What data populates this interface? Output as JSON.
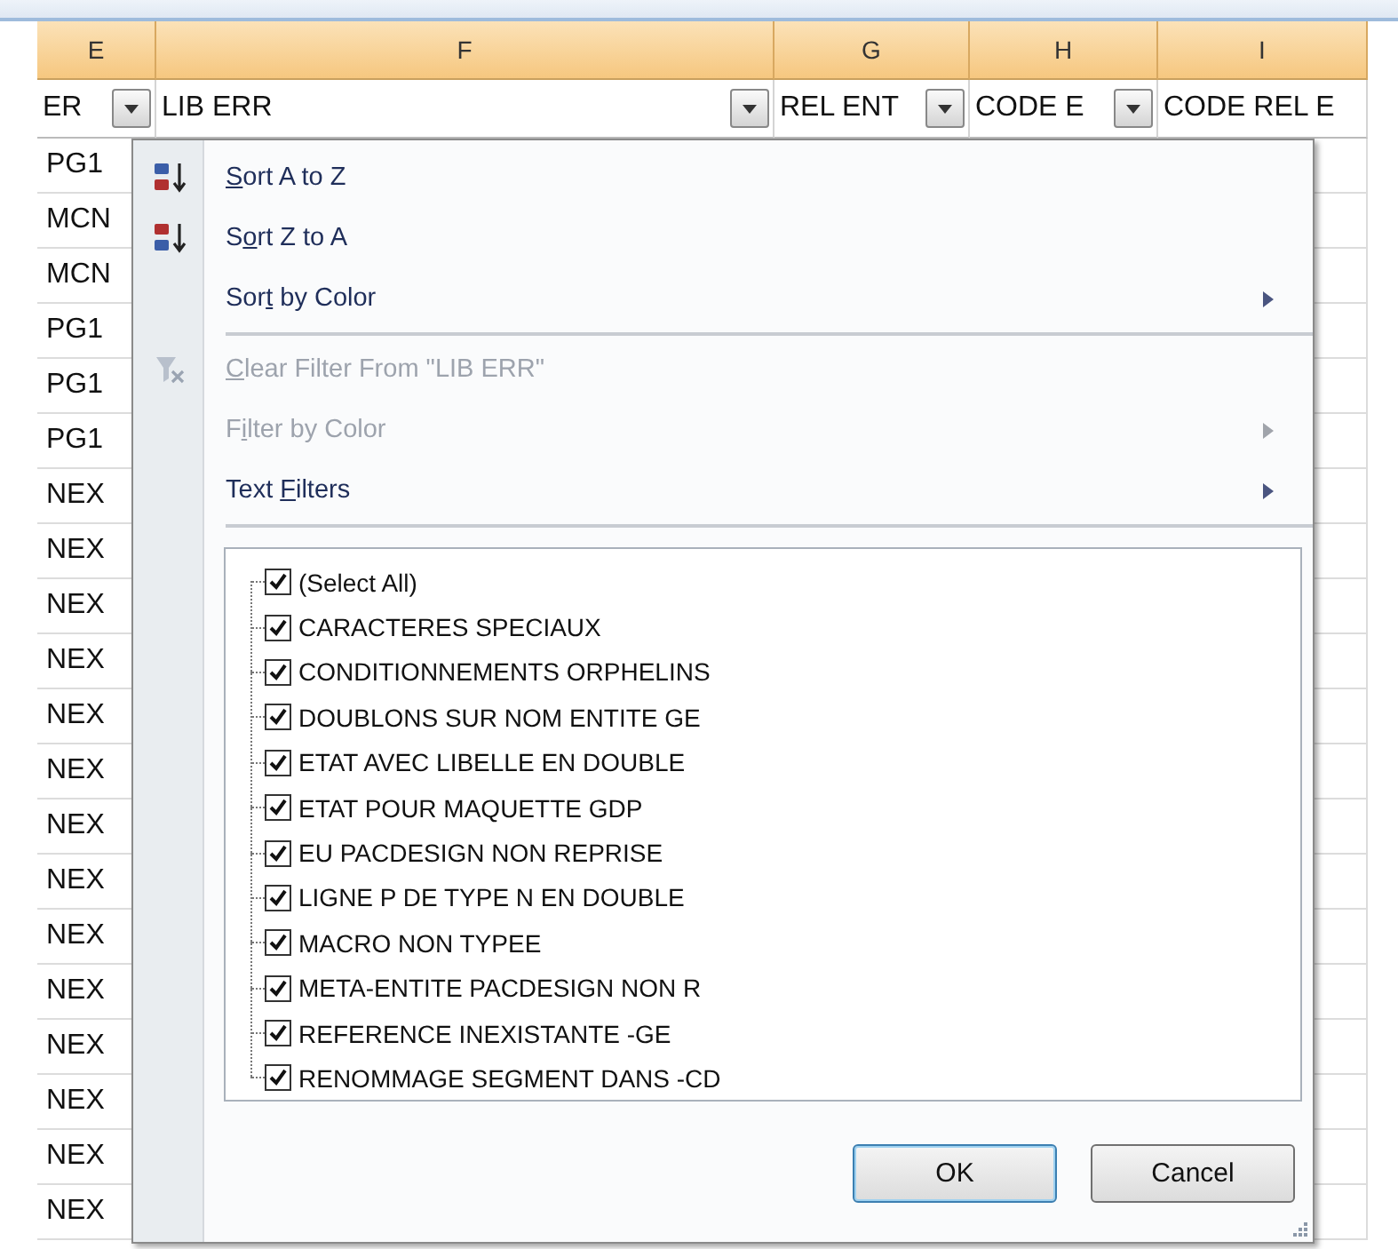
{
  "columns": [
    {
      "letter": "E"
    },
    {
      "letter": "F"
    },
    {
      "letter": "G"
    },
    {
      "letter": "H"
    },
    {
      "letter": "I"
    }
  ],
  "filter_row": [
    {
      "label": "ER",
      "filter_button": true
    },
    {
      "label": "LIB ERR",
      "filter_button": true
    },
    {
      "label": "REL ENT",
      "filter_button": true
    },
    {
      "label": "CODE E",
      "filter_button": true
    },
    {
      "label": "CODE REL E",
      "filter_button": false
    }
  ],
  "rows": [
    "PG1",
    "MCN",
    "MCN",
    "PG1",
    "PG1",
    "PG1",
    "NEX",
    "NEX",
    "NEX",
    "NEX",
    "NEX",
    "NEX",
    "NEX",
    "NEX",
    "NEX",
    "NEX",
    "NEX",
    "NEX",
    "NEX",
    "NEX"
  ],
  "filter_menu": {
    "items": [
      {
        "kind": "sort-ascending",
        "mnemonic": "S",
        "after": "ort A to Z",
        "disabled": false,
        "submenu": false
      },
      {
        "kind": "sort-descending",
        "before": "S",
        "mnemonic": "o",
        "after": "rt Z to A",
        "disabled": false,
        "submenu": false
      },
      {
        "kind": "command",
        "before": "Sor",
        "mnemonic": "t",
        "after": " by Color",
        "disabled": false,
        "submenu": true
      },
      {
        "kind": "separator"
      },
      {
        "kind": "clear-filter",
        "mnemonic": "C",
        "after": "lear Filter From \"LIB ERR\"",
        "disabled": true,
        "submenu": false
      },
      {
        "kind": "command",
        "before": "F",
        "mnemonic": "i",
        "after": "lter by Color",
        "disabled": true,
        "submenu": true
      },
      {
        "kind": "command",
        "before": "Text ",
        "mnemonic": "F",
        "after": "ilters",
        "disabled": false,
        "submenu": true
      },
      {
        "kind": "separator"
      }
    ],
    "values": [
      {
        "label": "(Select All)",
        "checked": true
      },
      {
        "label": "CARACTERES SPECIAUX",
        "checked": true
      },
      {
        "label": "CONDITIONNEMENTS ORPHELINS",
        "checked": true
      },
      {
        "label": "DOUBLONS SUR NOM ENTITE GE",
        "checked": true
      },
      {
        "label": "ETAT AVEC LIBELLE EN DOUBLE",
        "checked": true
      },
      {
        "label": "ETAT POUR MAQUETTE GDP",
        "checked": true
      },
      {
        "label": "EU PACDESIGN NON REPRISE",
        "checked": true
      },
      {
        "label": "LIGNE P DE TYPE N EN DOUBLE",
        "checked": true
      },
      {
        "label": "MACRO NON TYPEE",
        "checked": true
      },
      {
        "label": "META-ENTITE PACDESIGN NON R",
        "checked": true
      },
      {
        "label": "REFERENCE INEXISTANTE -GE",
        "checked": true
      },
      {
        "label": "RENOMMAGE SEGMENT DANS -CD",
        "checked": true
      }
    ],
    "buttons": [
      {
        "label": "OK",
        "default": true
      },
      {
        "label": "Cancel",
        "default": false
      }
    ]
  }
}
